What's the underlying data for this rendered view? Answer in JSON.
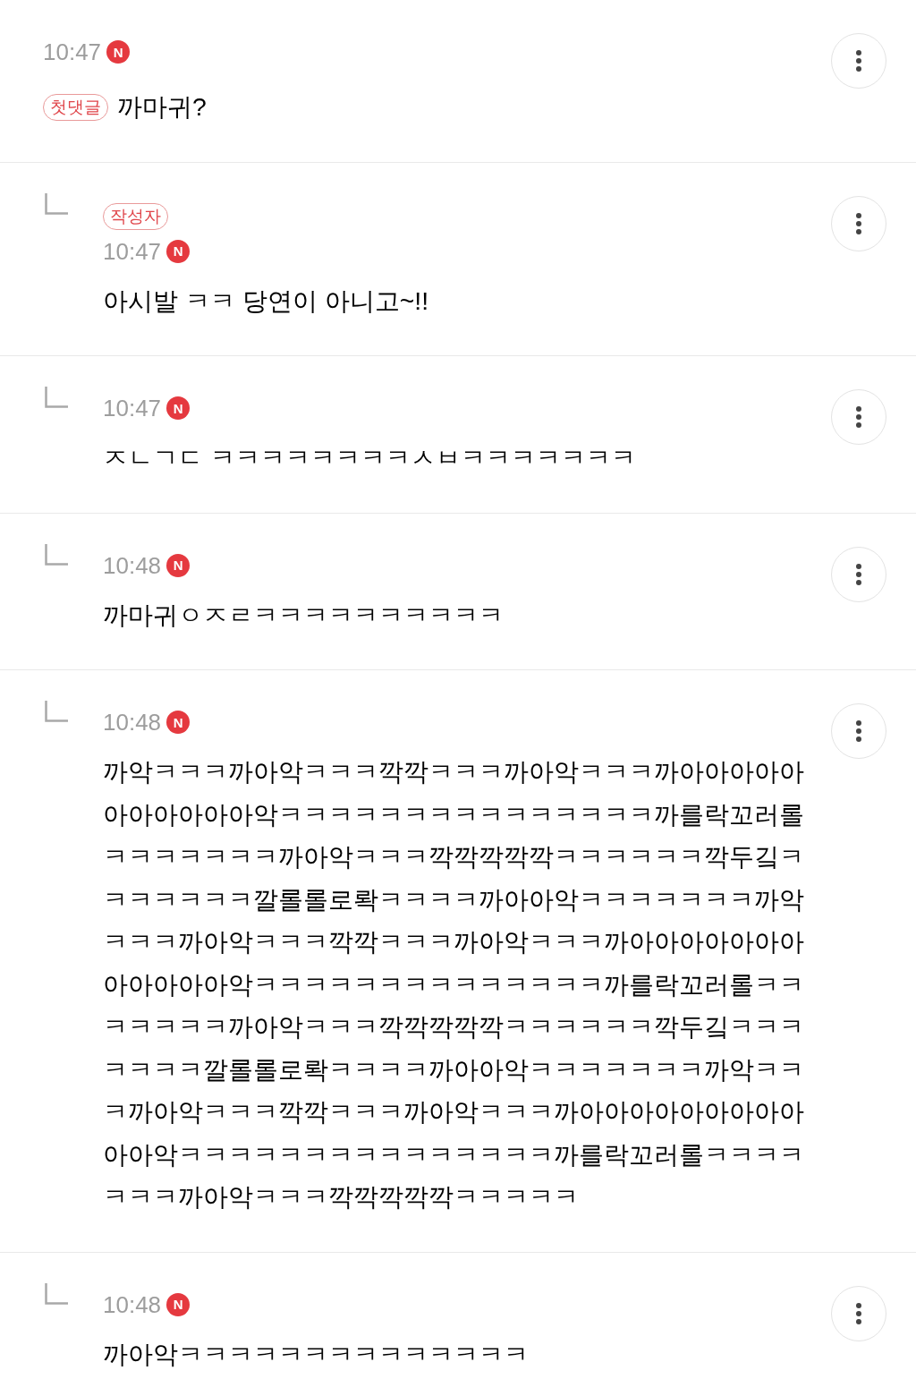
{
  "comments": [
    {
      "reply": false,
      "badge": {
        "kind": "first_comment",
        "label": "첫댓글"
      },
      "time": "10:47",
      "new_mark": "N",
      "text": "까마귀?"
    },
    {
      "reply": true,
      "badge": {
        "kind": "author",
        "label": "작성자"
      },
      "time": "10:47",
      "new_mark": "N",
      "text": "아시발 ㅋㅋ 당연이 아니고~!!"
    },
    {
      "reply": true,
      "time": "10:47",
      "new_mark": "N",
      "text": "ㅈㄴㄱㄷ ㅋㅋㅋㅋㅋㅋㅋㅋㅅㅂㅋㅋㅋㅋㅋㅋㅋ"
    },
    {
      "reply": true,
      "time": "10:48",
      "new_mark": "N",
      "text": "까마귀ㅇㅈㄹㅋㅋㅋㅋㅋㅋㅋㅋㅋㅋ"
    },
    {
      "reply": true,
      "time": "10:48",
      "new_mark": "N",
      "text": "까악ㅋㅋㅋ까아악ㅋㅋㅋ깍깍ㅋㅋㅋ까아악ㅋㅋㅋ까아아아아아아아아아아아악ㅋㅋㅋㅋㅋㅋㅋㅋㅋㅋㅋㅋㅋㅋㅋ까를락꼬러롤ㅋㅋㅋㅋㅋㅋㅋ까아악ㅋㅋㅋ깍깍깍깍깍ㅋㅋㅋㅋㅋㅋ깍두깈ㅋㅋㅋㅋㅋㅋㅋ깔롤롤로롹ㅋㅋㅋㅋ까아아악ㅋㅋㅋㅋㅋㅋㅋ까악ㅋㅋㅋ까아악ㅋㅋㅋ깍깍ㅋㅋㅋ까아악ㅋㅋㅋ까아아아아아아아아아아아아악ㅋㅋㅋㅋㅋㅋㅋㅋㅋㅋㅋㅋㅋㅋ까를락꼬러롤ㅋㅋㅋㅋㅋㅋㅋ까아악ㅋㅋㅋ깍깍깍깍깍ㅋㅋㅋㅋㅋㅋ깍두깈ㅋㅋㅋㅋㅋㅋㅋ깔롤롤로롹ㅋㅋㅋㅋ까아아악ㅋㅋㅋㅋㅋㅋㅋ까악ㅋㅋㅋ까아악ㅋㅋㅋ깍깍ㅋㅋㅋ까아악ㅋㅋㅋ까아아아아아아아아아아아악ㅋㅋㅋㅋㅋㅋㅋㅋㅋㅋㅋㅋㅋㅋㅋ까를락꼬러롤ㅋㅋㅋㅋㅋㅋㅋ까아악ㅋㅋㅋ깍깍깍깍깍ㅋㅋㅋㅋㅋ"
    },
    {
      "reply": true,
      "time": "10:48",
      "new_mark": "N",
      "text": "까아악ㅋㅋㅋㅋㅋㅋㅋㅋㅋㅋㅋㅋㅋㅋ"
    }
  ]
}
